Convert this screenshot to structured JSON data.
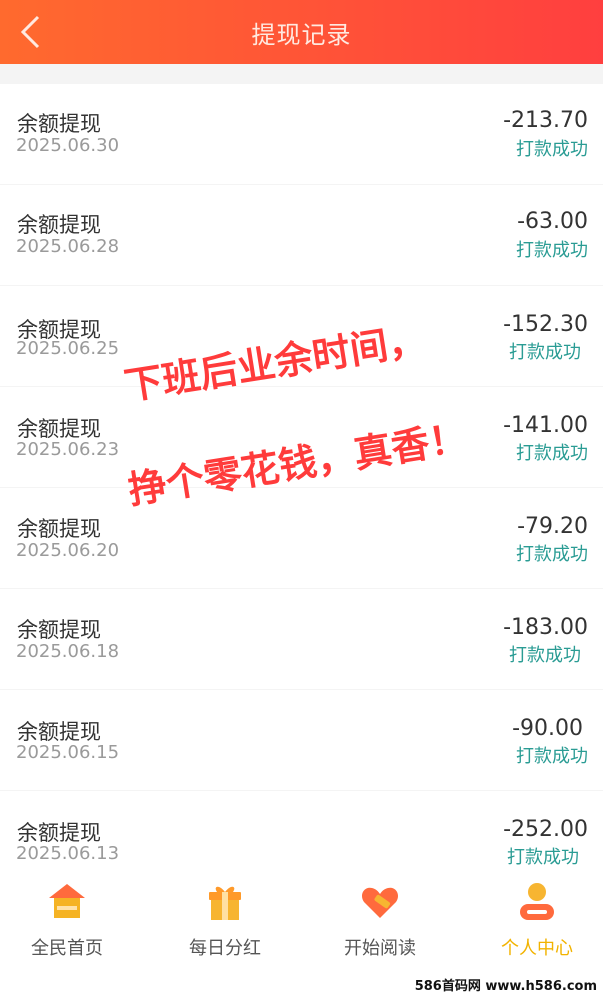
{
  "header": {
    "title": "提现记录"
  },
  "records": [
    {
      "label": "余额提现",
      "date": "2025.06.30",
      "amount": "-213.70",
      "status": "打款成功"
    },
    {
      "label": "余额提现",
      "date": "2025.06.28",
      "amount": "-63.00",
      "status": "打款成功"
    },
    {
      "label": "余额提现",
      "date": "2025.06.25",
      "amount": "-152.30",
      "status": "打款成功"
    },
    {
      "label": "余额提现",
      "date": "2025.06.23",
      "amount": "-141.00",
      "status": "打款成功"
    },
    {
      "label": "余额提现",
      "date": "2025.06.20",
      "amount": "-79.20",
      "status": "打款成功"
    },
    {
      "label": "余额提现",
      "date": "2025.06.18",
      "amount": "-183.00",
      "status": "打款成功"
    },
    {
      "label": "余额提现",
      "date": "2025.06.15",
      "amount": "-90.00",
      "status": "打款成功"
    },
    {
      "label": "余额提现",
      "date": "2025.06.13",
      "amount": "-252.00",
      "status": "打款成功"
    }
  ],
  "tabs": [
    {
      "label": "全民首页",
      "icon": "home-icon"
    },
    {
      "label": "每日分红",
      "icon": "gift-icon"
    },
    {
      "label": "开始阅读",
      "icon": "tag-heart-icon"
    },
    {
      "label": "个人中心",
      "icon": "user-icon",
      "active": true
    }
  ],
  "overlay": {
    "line1": "下班后业余时间，",
    "line2": "挣个零花钱，真香！"
  },
  "watermark": "586首码网 www.h586.com",
  "colors": {
    "header_start": "#ff6a2e",
    "header_end": "#ff3f3f",
    "status": "#2a9c94",
    "active_tab": "#f2b300",
    "overlay_text": "#ff3b3b"
  }
}
